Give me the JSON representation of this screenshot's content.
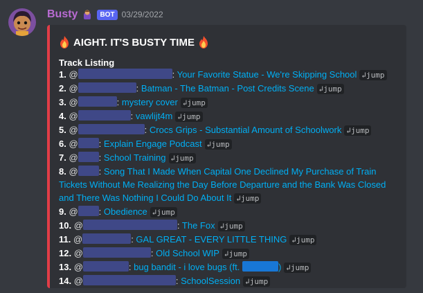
{
  "message": {
    "username": "Busty",
    "bot_tag": "BOT",
    "timestamp": "03/29/2022"
  },
  "embed": {
    "accent_color": "#e13d47",
    "title": "AIGHT. IT'S BUSTY TIME",
    "title_icon": "fire-emoji",
    "track_heading": "Track Listing",
    "jump_label": "↲jump",
    "mention_symbol": "@",
    "tracks": [
      {
        "num": "1.",
        "title": "Your Favorite Statue - We're Skipping School"
      },
      {
        "num": "2.",
        "title": "Batman - The Batman - Post Credits Scene"
      },
      {
        "num": "3.",
        "title": "mystery cover"
      },
      {
        "num": "4.",
        "title": "vawlijt4m"
      },
      {
        "num": "5.",
        "title": "Crocs Grips - Substantial Amount of Schoolwork"
      },
      {
        "num": "6.",
        "title": "Explain Engage Podcast"
      },
      {
        "num": "7.",
        "title": "School Training"
      },
      {
        "num": "8.",
        "title": "Song That I Made When Capital One Declined My Purchase of Train Tickets Without Me Realizing the Day Before Departure and the Bank Was Closed and There Was Nothing I Could Do About It"
      },
      {
        "num": "9.",
        "title": "Obedience"
      },
      {
        "num": "10.",
        "title": "The Fox"
      },
      {
        "num": "11.",
        "title": "GAL GREAT - EVERY LITTLE THING"
      },
      {
        "num": "12.",
        "title": "Old School WIP"
      },
      {
        "num": "13.",
        "title_prefix": "bug bandit - i love bugs (ft. ",
        "title_suffix": ")"
      },
      {
        "num": "14.",
        "title": "SchoolSession"
      }
    ]
  }
}
